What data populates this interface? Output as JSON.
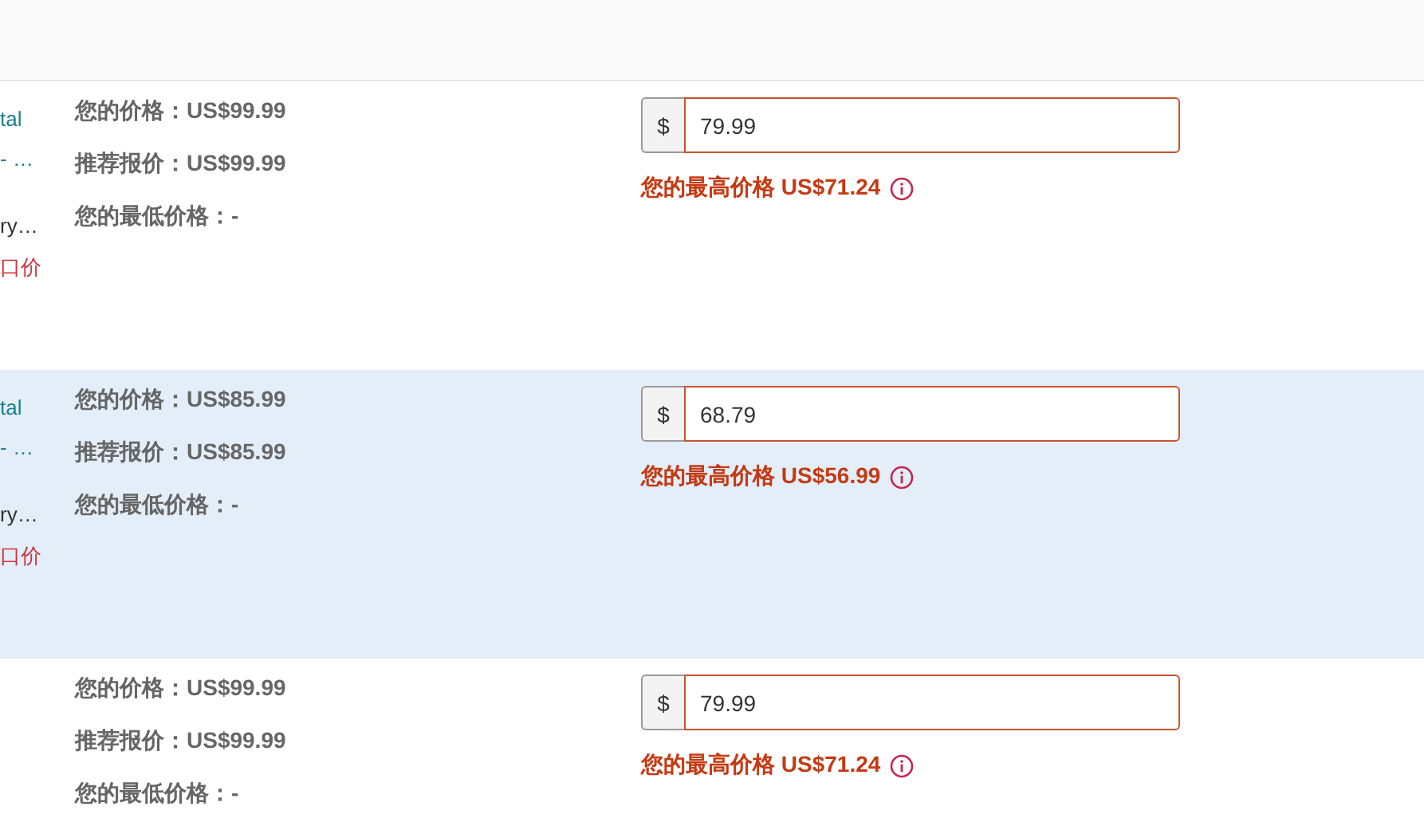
{
  "rows": [
    {
      "selected": false,
      "product": {
        "title": "tal",
        "subtitle": "- …",
        "detail": "ry…",
        "tag": "口价"
      },
      "your_price": "您的价格：US$99.99",
      "suggested_price": "推荐报价：US$99.99",
      "lowest_price": "您的最低价格：-",
      "currency": "$",
      "price_input": "79.99",
      "max_price_hint": "您的最高价格 US$71.24"
    },
    {
      "selected": true,
      "product": {
        "title": "tal",
        "subtitle": "- …",
        "detail": "ry…",
        "tag": "口价"
      },
      "your_price": "您的价格：US$85.99",
      "suggested_price": "推荐报价：US$85.99",
      "lowest_price": "您的最低价格：-",
      "currency": "$",
      "price_input": "68.79",
      "max_price_hint": "您的最高价格 US$56.99"
    },
    {
      "selected": false,
      "your_price": "您的价格：US$99.99",
      "suggested_price": "推荐报价：US$99.99",
      "lowest_price": "您的最低价格：-",
      "currency": "$",
      "price_input": "79.99",
      "max_price_hint": "您的最高价格 US$71.24"
    }
  ]
}
